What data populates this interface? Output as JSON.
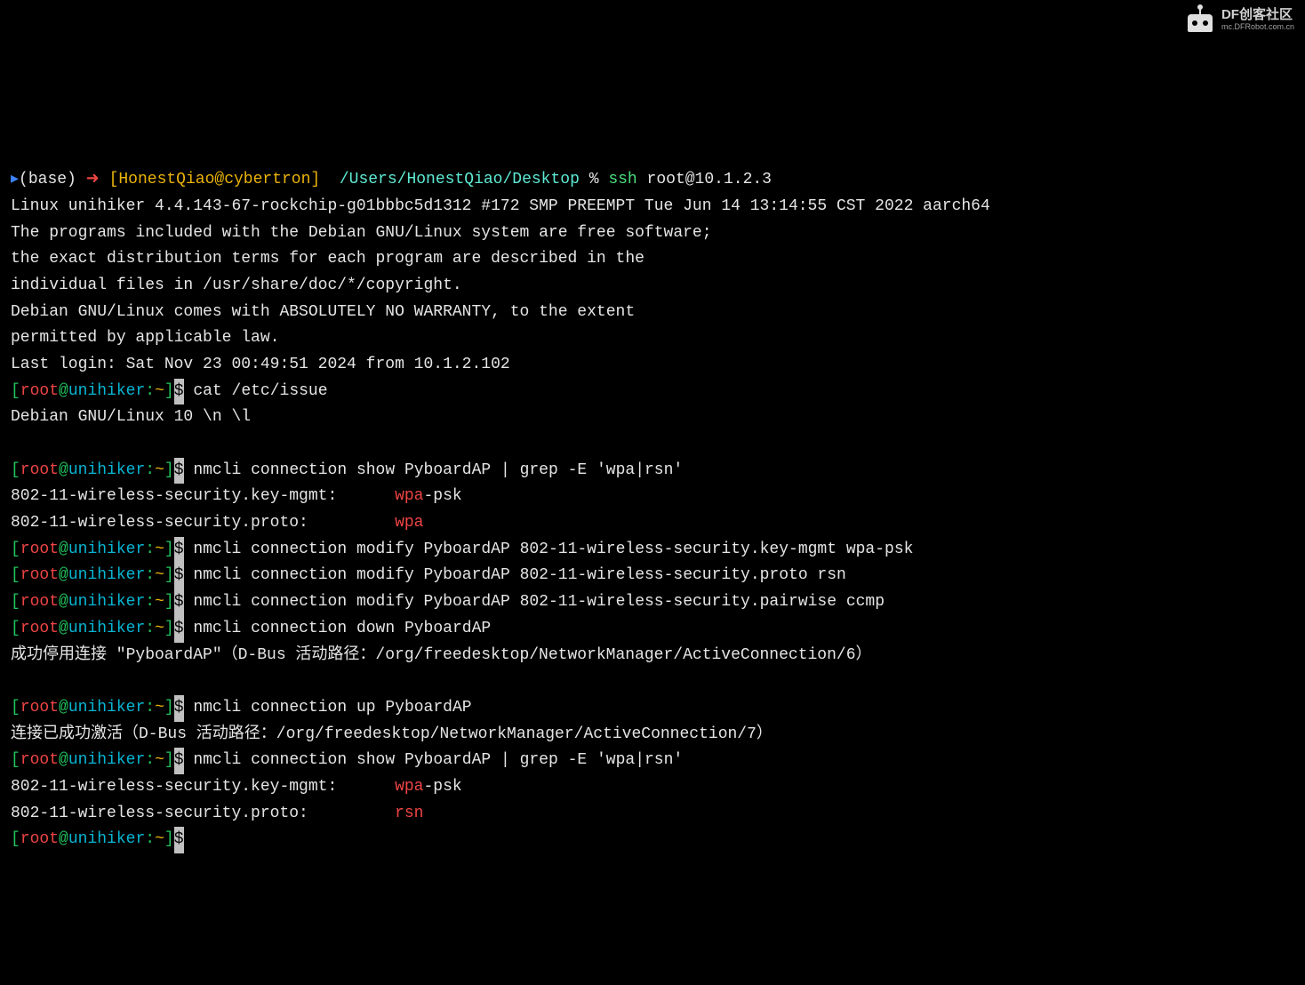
{
  "watermark": {
    "main": "DF创客社区",
    "sub": "mc.DFRobot.com.cn"
  },
  "local_prompt": {
    "cursor_char": "▸",
    "base": "(base)",
    "arrow": "➜",
    "bracket_open": " [",
    "host": "HonestQiao@cybertron",
    "bracket_close": "]",
    "path": "/Users/HonestQiao/Desktop",
    "percent": "%",
    "cmd": "ssh",
    "arg": "root@10.1.2.3"
  },
  "banner": [
    "Linux unihiker 4.4.143-67-rockchip-g01bbbc5d1312 #172 SMP PREEMPT Tue Jun 14 13:14:55 CST 2022 aarch64",
    "",
    "The programs included with the Debian GNU/Linux system are free software;",
    "the exact distribution terms for each program are described in the",
    "individual files in /usr/share/doc/*/copyright.",
    "",
    "Debian GNU/Linux comes with ABSOLUTELY NO WARRANTY, to the extent",
    "permitted by applicable law.",
    "Last login: Sat Nov 23 00:49:51 2024 from 10.1.2.102"
  ],
  "remote_prompt": {
    "open_bracket": "[",
    "user": "root",
    "at": "@",
    "host": "unihiker",
    "colon": ":",
    "path": "~",
    "close_bracket": "]",
    "dollar": "$"
  },
  "commands": {
    "cat_issue": "cat /etc/issue",
    "issue_output": "Debian GNU/Linux 10 \\n \\l",
    "show1": "nmcli connection show PyboardAP | grep -E 'wpa|rsn'",
    "show1_out1_key": "802-11-wireless-security.key-mgmt:",
    "show1_out1_val_red": "wpa",
    "show1_out1_val_rest": "-psk",
    "show1_out2_key": "802-11-wireless-security.proto:",
    "show1_out2_val_red": "wpa",
    "modify1": "nmcli connection modify PyboardAP 802-11-wireless-security.key-mgmt wpa-psk",
    "modify2": "nmcli connection modify PyboardAP 802-11-wireless-security.proto rsn",
    "modify3": "nmcli connection modify PyboardAP 802-11-wireless-security.pairwise ccmp",
    "down": "nmcli connection down PyboardAP",
    "down_output": "成功停用连接 \"PyboardAP\"（D-Bus 活动路径：/org/freedesktop/NetworkManager/ActiveConnection/6）",
    "up": "nmcli connection up PyboardAP",
    "up_output": "连接已成功激活（D-Bus 活动路径：/org/freedesktop/NetworkManager/ActiveConnection/7）",
    "show2": "nmcli connection show PyboardAP | grep -E 'wpa|rsn'",
    "show2_out1_key": "802-11-wireless-security.key-mgmt:",
    "show2_out1_val_red": "wpa",
    "show2_out1_val_rest": "-psk",
    "show2_out2_key": "802-11-wireless-security.proto:",
    "show2_out2_val_red": "rsn"
  }
}
